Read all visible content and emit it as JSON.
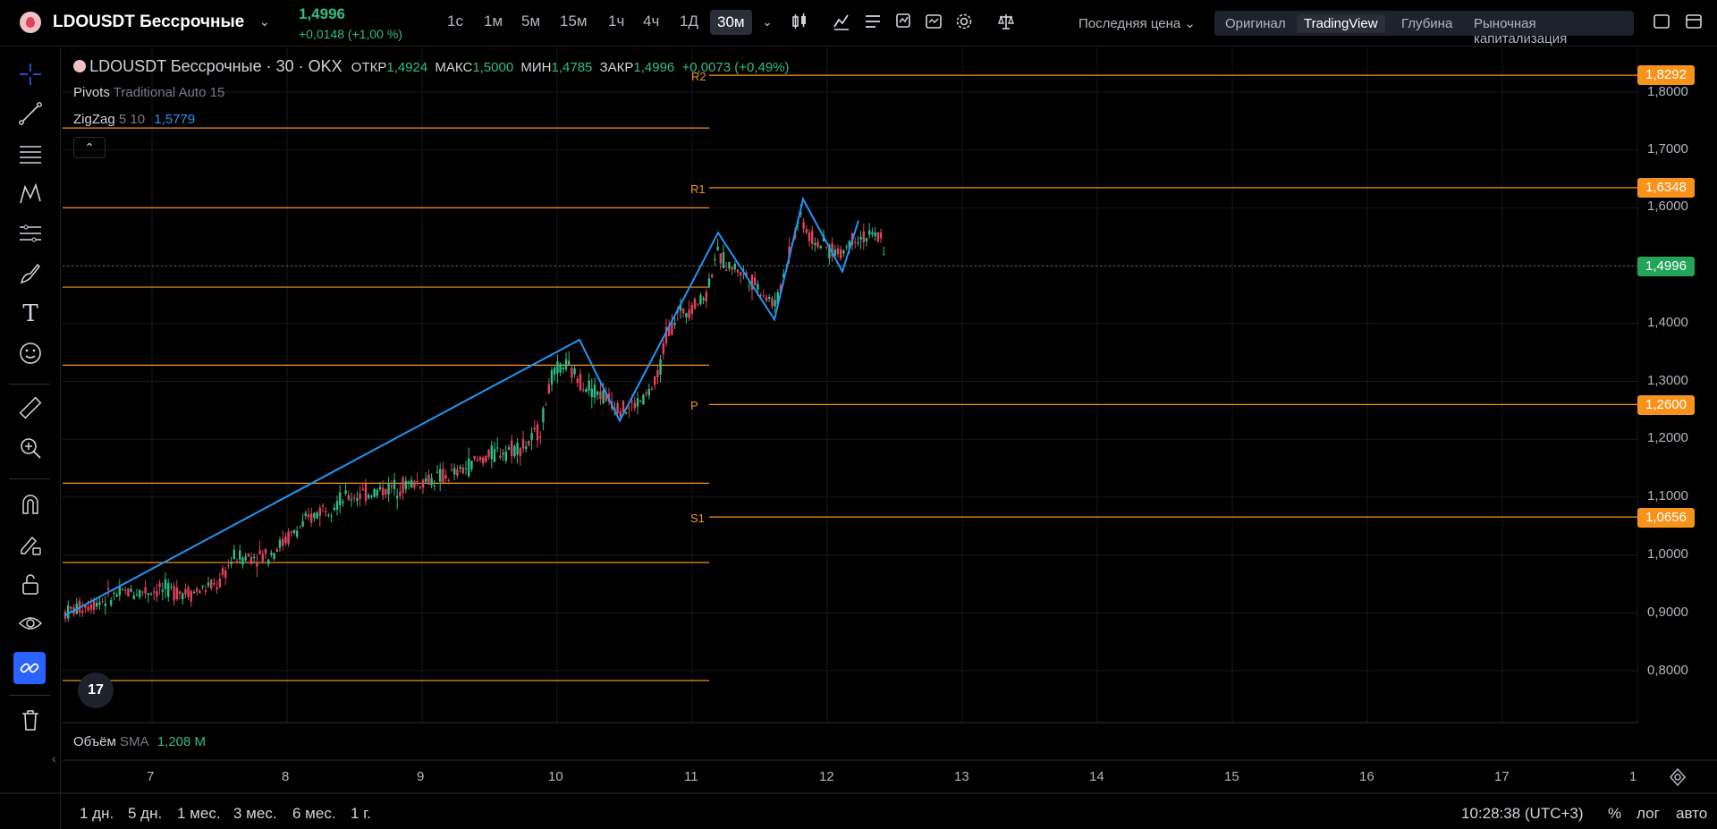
{
  "topbar": {
    "symbol": "LDOUSDT Бессрочные",
    "price": "1,4996",
    "change": "+0,0148 (+1,00 %)",
    "timeframes": [
      "1с",
      "1м",
      "5м",
      "15м",
      "1ч",
      "4ч",
      "1Д",
      "30м"
    ],
    "active_timeframe": "30м",
    "price_source": "Последняя цена",
    "views": [
      "Оригинал",
      "TradingView",
      "Глубина",
      "Рыночная капитализация"
    ],
    "active_view": "TradingView"
  },
  "legend": {
    "title": "LDOUSDT Бессрочные · 30 · OKX",
    "open_label": "ОТКР",
    "open": "1,4924",
    "high_label": "МАКС",
    "high": "1,5000",
    "low_label": "МИН",
    "low": "1,4785",
    "close_label": "ЗАКР",
    "close": "1,4996",
    "change": "+0,0073 (+0,49%)",
    "pivots_name": "Pivots",
    "pivots_params": "Traditional Auto 15",
    "zigzag_name": "ZigZag",
    "zigzag_params": "5 10",
    "zigzag_value": "1,5779"
  },
  "price_axis": [
    "1,8000",
    "1,7000",
    "1,6000",
    "1,4000",
    "1,3000",
    "1,2000",
    "1,1000",
    "1,0000",
    "0,9000",
    "0,8000"
  ],
  "price_labels": [
    {
      "value": "1,8292",
      "color": "#f7931a"
    },
    {
      "value": "1,6348",
      "color": "#f7931a"
    },
    {
      "value": "1,4996",
      "color": "#22a559"
    },
    {
      "value": "1,2600",
      "color": "#f7931a"
    },
    {
      "value": "1,0656",
      "color": "#f7931a"
    }
  ],
  "pivot_names": [
    "R2",
    "R1",
    "P",
    "S1"
  ],
  "time_axis": [
    "7",
    "8",
    "9",
    "10",
    "11",
    "12",
    "13",
    "14",
    "15",
    "16",
    "17",
    "1"
  ],
  "volume": {
    "label": "Объём",
    "sma": "SMA",
    "value": "1,208 M"
  },
  "ranges": [
    "1 дн.",
    "5 дн.",
    "1 мес.",
    "3 мес.",
    "6 мес.",
    "1 г."
  ],
  "clock": "10:28:38 (UTC+3)",
  "axis_options": [
    "%",
    "лог",
    "авто"
  ],
  "tv_logo": "17",
  "colors": {
    "up": "#2ebd85",
    "down": "#e2435a",
    "pivot": "#f7931a",
    "zigzag": "#2196f3"
  }
}
